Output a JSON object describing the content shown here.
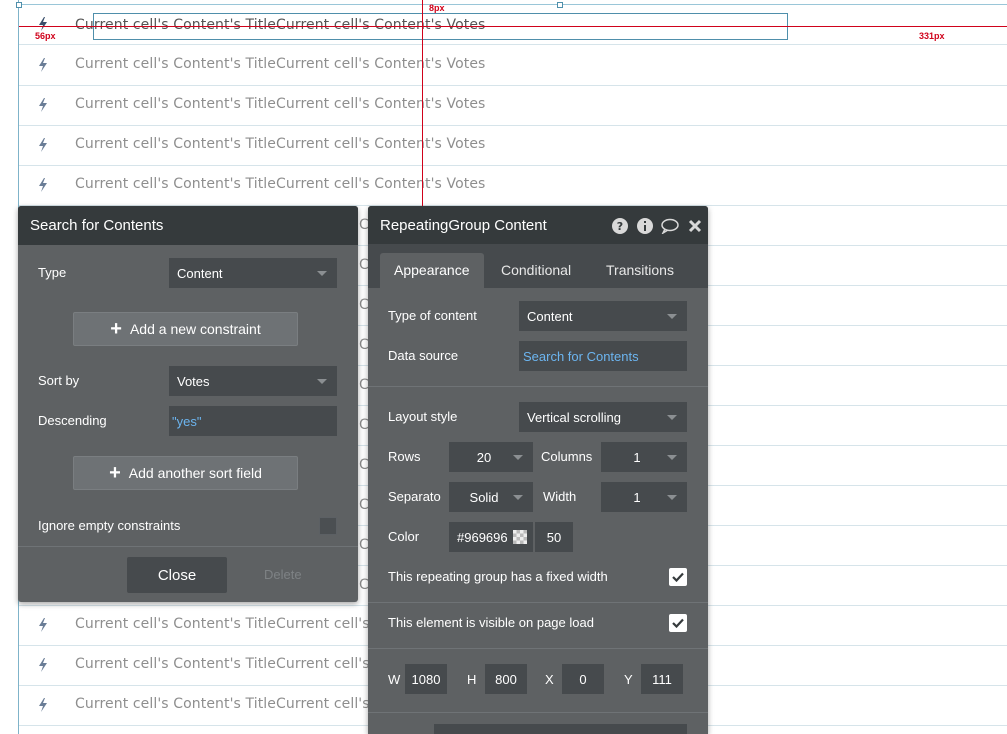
{
  "canvas": {
    "row_text": "Current cell's Content's TitleCurrent cell's Content's Votes",
    "row_text_truncated": "Current cell's Content's TitleCurrent cell's C",
    "guides": {
      "top_distance": "8px",
      "left_distance": "56px",
      "right_distance": "331px"
    }
  },
  "search_panel": {
    "title": "Search for Contents",
    "type_label": "Type",
    "type_value": "Content",
    "add_constraint": "Add a new constraint",
    "sort_label": "Sort by",
    "sort_value": "Votes",
    "descending_label": "Descending",
    "descending_value": "\"yes\"",
    "add_sort": "Add another sort field",
    "ignore_label": "Ignore empty constraints",
    "close": "Close",
    "delete": "Delete"
  },
  "prop_panel": {
    "title": "RepeatingGroup Content",
    "tabs": [
      "Appearance",
      "Conditional",
      "Transitions"
    ],
    "type_of_content_label": "Type of content",
    "type_of_content_value": "Content",
    "data_source_label": "Data source",
    "data_source_value": "Search for Contents",
    "layout_label": "Layout style",
    "layout_value": "Vertical scrolling",
    "rows_label": "Rows",
    "rows_value": "20",
    "columns_label": "Columns",
    "columns_value": "1",
    "separator_label": "Separato",
    "separator_value": "Solid",
    "width_label": "Width",
    "width_value": "1",
    "color_label": "Color",
    "color_value": "#969696",
    "color_opacity": "50",
    "fixed_width_label": "This repeating group has a fixed width",
    "fixed_width_checked": true,
    "visible_label": "This element is visible on page load",
    "visible_checked": true,
    "w_label": "W",
    "w_value": "1080",
    "h_label": "H",
    "h_value": "800",
    "x_label": "X",
    "x_value": "0",
    "y_label": "Y",
    "y_value": "111"
  },
  "colors": {
    "panel_bg": "#5e6163",
    "panel_header": "#353a3c",
    "field_bg": "#464a4d",
    "link_blue": "#6cb5f0",
    "guide_red": "#d0021b",
    "rg_border": "#4f8fab"
  }
}
